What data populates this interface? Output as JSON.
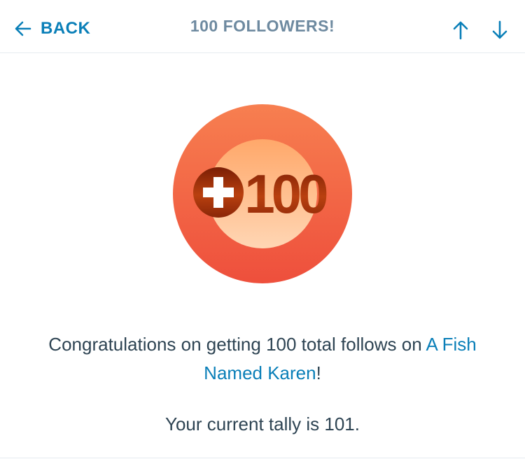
{
  "header": {
    "back_label": "BACK",
    "title": "100 FOLLOWERS!",
    "back_icon": "arrow-left-icon",
    "prev_icon": "arrow-up-icon",
    "next_icon": "arrow-down-icon"
  },
  "badge": {
    "text": "100",
    "icon": "plus-icon"
  },
  "message": {
    "prefix": "Congratulations on getting 100 total follows on ",
    "site_link": "A Fish Named Karen",
    "suffix": "!"
  },
  "tally": "Your current tally is 101.",
  "colors": {
    "accent": "#0a7fb8",
    "title": "#6e8aa0",
    "body_text": "#2e4453",
    "badge_outer_top": "#f77f50",
    "badge_outer_bottom": "#ee4f3c",
    "badge_inner_top": "#ffa86a",
    "badge_inner_bottom": "#ffd6b4",
    "badge_number": "#a8330e"
  }
}
